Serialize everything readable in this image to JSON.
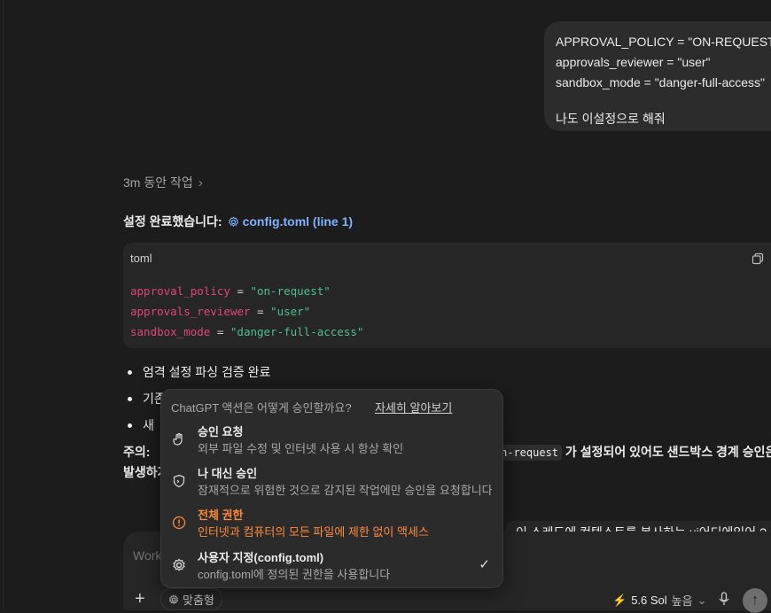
{
  "user_message": {
    "lines": [
      "APPROVAL_POLICY = \"ON-REQUEST\"",
      "approvals_reviewer = \"user\"",
      "sandbox_mode = \"danger-full-access\""
    ],
    "request": "나도 이설정으로 해줘"
  },
  "assistant": {
    "worked_label": "3m 동안 작업",
    "done_text": "설정 완료했습니다:",
    "file_ref": "config.toml (line 1)",
    "code": {
      "lang": "toml",
      "lines": [
        {
          "key": "approval_policy",
          "op": " = ",
          "val": "\"on-request\""
        },
        {
          "key": "approvals_reviewer",
          "op": " = ",
          "val": "\"user\""
        },
        {
          "key": "sandbox_mode",
          "op": " = ",
          "val": "\"danger-full-access\""
        }
      ]
    },
    "bullets": [
      "엄격 설정 파싱 검증 완료",
      "기존",
      "새 "
    ],
    "note_prefix": "주의:",
    "note_code_start": "c",
    "note_code": "n-request",
    "note_tail": "가 설정되어 있어도 샌드박스 경계 승인은",
    "note_line2": "발생하지"
  },
  "floating_text": "이 스레드에 컨텍스트를 복사하는 ui어디에있어 ?",
  "composer": {
    "placeholder": "Work",
    "permission_label": "맞춤형",
    "model_label": "5.6 Sol",
    "effort_label": "높음"
  },
  "approval_menu": {
    "header": "ChatGPT 액션은 어떻게 승인할까요?",
    "learn_more": "자세히 알아보기",
    "options": [
      {
        "title": "승인 요청",
        "desc": "외부 파일 수정 및 인터넷 사용 시 항상 확인",
        "icon": "hand-icon"
      },
      {
        "title": "나 대신 승인",
        "desc": "잠재적으로 위험한 것으로 감지된 작업에만 승인을 요청합니다",
        "icon": "shield-icon"
      },
      {
        "title": "전체 권한",
        "desc": "인터넷과 컴퓨터의 모든 파일에 제한 없이 액세스",
        "icon": "warning-icon",
        "danger_color": "#ff8a3d"
      },
      {
        "title": "사용자 지정(config.toml)",
        "desc": "config.toml에 정의된 권한을 사용합니다",
        "icon": "gear-icon",
        "selected": true
      }
    ]
  },
  "colors": {
    "background": "#1c1c1c",
    "accent_link": "#7fb2ff",
    "danger": "#ff8a3d",
    "code_key": "#e0467a",
    "code_string": "#4fbf8f"
  }
}
